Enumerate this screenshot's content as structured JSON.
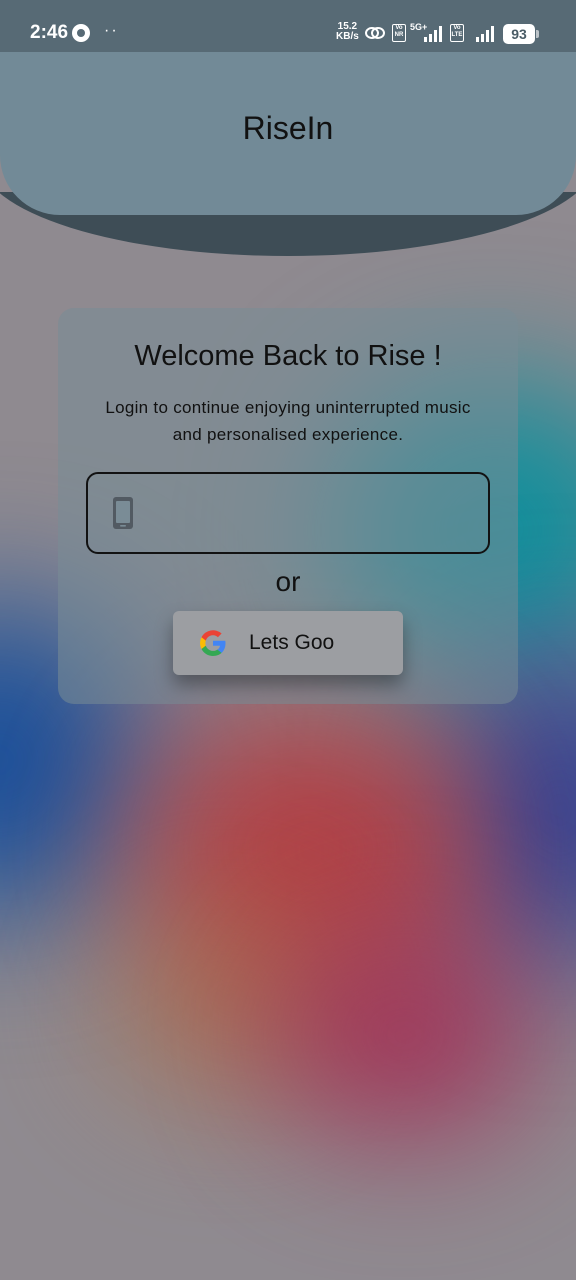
{
  "status_bar": {
    "time": "2:46",
    "dots": "··",
    "net_speed_value": "15.2",
    "net_speed_unit": "KB/s",
    "network_label": "5G+",
    "volte_1": "Vo NR",
    "volte_2": "Vo LTE",
    "battery": "93"
  },
  "header": {
    "app_title": "RiseIn"
  },
  "login_card": {
    "title": "Welcome Back to Rise !",
    "subtitle": "Login to continue enjoying uninterrupted music and personalised experience.",
    "phone_input_value": "",
    "phone_input_placeholder": "",
    "or_text": "or",
    "google_button_label": "Lets Goo"
  },
  "colors": {
    "header": "#728a97",
    "status_bar": "#576a75",
    "arc": "#3e4d56",
    "background": "#8f8a90"
  },
  "icons": {
    "phone": "phone-icon",
    "google": "google-icon"
  }
}
